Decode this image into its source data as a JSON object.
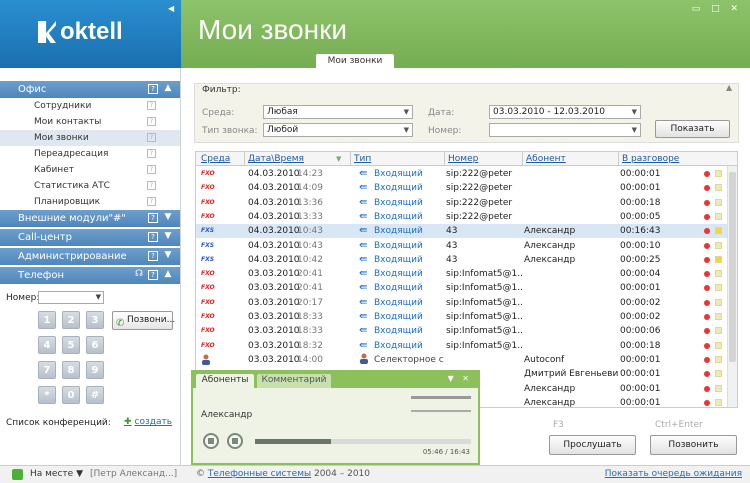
{
  "app": {
    "logo": "oktell",
    "title": "Мои звонки",
    "active_tab": "Мои звонки"
  },
  "sidebar": {
    "sections": [
      {
        "label": "Офис",
        "items": [
          "Сотрудники",
          "Мои контакты",
          "Мои звонки",
          "Переадресация",
          "Кабинет",
          "Статистика АТС",
          "Планировщик"
        ],
        "active": "Мои звонки"
      },
      {
        "label": "Внешние модули\"#\""
      },
      {
        "label": "Call-центр"
      },
      {
        "label": "Администрирование"
      },
      {
        "label": "Телефон"
      }
    ],
    "phone": {
      "number_label": "Номер:",
      "number_value": "",
      "keys": [
        "1",
        "2",
        "3",
        "4",
        "5",
        "6",
        "7",
        "8",
        "9",
        "*",
        "0",
        "#"
      ],
      "call_button": "Позвони...",
      "conf_label": "Список конференций:",
      "conf_create": "создать"
    }
  },
  "filter": {
    "title": "Фильтр:",
    "source_label": "Среда:",
    "source_value": "Любая",
    "calltype_label": "Тип звонка:",
    "calltype_value": "Любой",
    "date_label": "Дата:",
    "date_value": "03.03.2010 - 12.03.2010",
    "number_label": "Номер:",
    "number_value": "",
    "show_button": "Показать"
  },
  "table": {
    "columns": [
      "Среда",
      "Дата\\Время",
      "Тип",
      "Номер",
      "Абонент",
      "В разговоре"
    ],
    "rows": [
      {
        "src": "FXO",
        "date": "04.03.2010",
        "time": "14:23",
        "type": "Входящий",
        "num": "sip:222@peter",
        "abon": "",
        "dur": "00:00:01",
        "flag": false
      },
      {
        "src": "FXO",
        "date": "04.03.2010",
        "time": "14:09",
        "type": "Входящий",
        "num": "sip:222@peter",
        "abon": "",
        "dur": "00:00:01",
        "flag": false
      },
      {
        "src": "FXO",
        "date": "04.03.2010",
        "time": "13:36",
        "type": "Входящий",
        "num": "sip:222@peter",
        "abon": "",
        "dur": "00:00:18",
        "flag": false
      },
      {
        "src": "FXO",
        "date": "04.03.2010",
        "time": "13:33",
        "type": "Входящий",
        "num": "sip:222@peter",
        "abon": "",
        "dur": "00:00:05",
        "flag": false
      },
      {
        "src": "FXS",
        "date": "04.03.2010",
        "time": "10:43",
        "type": "Входящий",
        "num": "43",
        "abon": "Александр",
        "dur": "00:16:43",
        "flag": true,
        "selected": true
      },
      {
        "src": "FXS",
        "date": "04.03.2010",
        "time": "10:43",
        "type": "Входящий",
        "num": "43",
        "abon": "Александр",
        "dur": "00:00:10",
        "flag": false
      },
      {
        "src": "FXS",
        "date": "04.03.2010",
        "time": "10:42",
        "type": "Входящий",
        "num": "43",
        "abon": "Александр",
        "dur": "00:00:25",
        "flag": true
      },
      {
        "src": "FXO",
        "date": "03.03.2010",
        "time": "20:41",
        "type": "Входящий",
        "num": "sip:Infomat5@1...",
        "abon": "",
        "dur": "00:00:04",
        "flag": false
      },
      {
        "src": "FXO",
        "date": "03.03.2010",
        "time": "20:41",
        "type": "Входящий",
        "num": "sip:Infomat5@1...",
        "abon": "",
        "dur": "00:00:01",
        "flag": false
      },
      {
        "src": "FXO",
        "date": "03.03.2010",
        "time": "20:17",
        "type": "Входящий",
        "num": "sip:Infomat5@1...",
        "abon": "",
        "dur": "00:00:02",
        "flag": false
      },
      {
        "src": "FXO",
        "date": "03.03.2010",
        "time": "18:33",
        "type": "Входящий",
        "num": "sip:Infomat5@1...",
        "abon": "",
        "dur": "00:00:02",
        "flag": false
      },
      {
        "src": "FXO",
        "date": "03.03.2010",
        "time": "18:33",
        "type": "Входящий",
        "num": "sip:Infomat5@1...",
        "abon": "",
        "dur": "00:00:06",
        "flag": false
      },
      {
        "src": "FXO",
        "date": "03.03.2010",
        "time": "18:32",
        "type": "Входящий",
        "num": "sip:Infomat5@1...",
        "abon": "",
        "dur": "00:00:18",
        "flag": false
      },
      {
        "src": "",
        "date": "03.03.2010",
        "time": "14:00",
        "type": "Селекторное с...",
        "num": "",
        "abon": "Autoconf",
        "dur": "00:00:01",
        "flag": false,
        "conf": true
      },
      {
        "src": "",
        "date": "",
        "time": "",
        "type": "",
        "num": "",
        "abon": "Дмитрий Евгеньевич",
        "dur": "00:00:01",
        "flag": false
      },
      {
        "src": "",
        "date": "",
        "time": "",
        "type": "",
        "num": "",
        "abon": "Александр",
        "dur": "00:00:01",
        "flag": false
      },
      {
        "src": "",
        "date": "",
        "time": "",
        "type": "",
        "num": "",
        "abon": "Александр",
        "dur": "00:00:01",
        "flag": false
      }
    ]
  },
  "actions": {
    "hint_listen": "F3",
    "listen": "Прослушать",
    "hint_call": "Ctrl+Enter",
    "call": "Позвонить"
  },
  "player": {
    "tab_abonents": "Абоненты",
    "tab_comment": "Комментарий",
    "name": "Александр",
    "time": "05:46 / 16:43",
    "progress": 0.35
  },
  "statusbar": {
    "status": "На месте",
    "user": "[Петр Александ...]",
    "copyright_prefix": "©",
    "copyright_link": "Телефонные системы",
    "copyright_years": "2004 – 2010",
    "queue_link": "Показать очередь ожидания"
  }
}
